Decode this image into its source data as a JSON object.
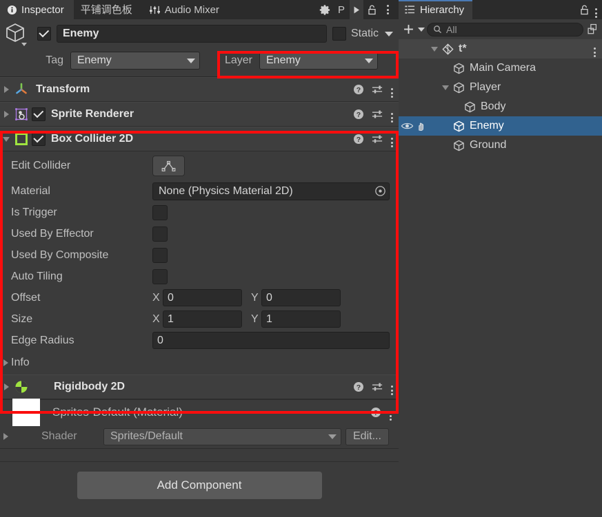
{
  "inspector": {
    "tabs": [
      {
        "label": "Inspector",
        "icon": "info-icon",
        "active": true
      },
      {
        "label": "平铺调色板",
        "icon": "",
        "active": false
      },
      {
        "label": "Audio Mixer",
        "icon": "mixer-icon",
        "active": false
      }
    ],
    "toolbar_right": [
      {
        "name": "gear-icon",
        "label": ""
      },
      {
        "name": "preview-p-label",
        "label": "P"
      },
      {
        "name": "play-icon",
        "label": ""
      },
      {
        "name": "lock-icon",
        "label": ""
      },
      {
        "name": "more-menu-icon",
        "label": ""
      }
    ],
    "object": {
      "icon": "gameobject-cube-icon",
      "enabled_checkbox": true,
      "name": "Enemy",
      "static_checkbox": false,
      "static_label": "Static",
      "tag_label": "Tag",
      "tag_value": "Enemy",
      "layer_label": "Layer",
      "layer_value": "Enemy"
    },
    "components": [
      {
        "title": "Transform",
        "icon": "transform-axis-icon",
        "expanded": false,
        "has_checkbox": false
      },
      {
        "title": "Sprite Renderer",
        "icon": "sprite-renderer-icon",
        "expanded": false,
        "has_checkbox": true,
        "checked": true
      },
      {
        "title": "Box Collider 2D",
        "icon": "box-collider-2d-icon",
        "expanded": true,
        "has_checkbox": true,
        "checked": true
      },
      {
        "title": "Rigidbody 2D",
        "icon": "rigidbody-2d-icon",
        "expanded": false,
        "has_checkbox": false
      }
    ],
    "box_collider": {
      "edit_collider_label": "Edit Collider",
      "edit_collider_button_icon": "polygon-edit-icon",
      "material_label": "Material",
      "material_value": "None (Physics Material 2D)",
      "is_trigger_label": "Is Trigger",
      "is_trigger_value": false,
      "used_by_effector_label": "Used By Effector",
      "used_by_effector_value": false,
      "used_by_composite_label": "Used By Composite",
      "used_by_composite_value": false,
      "auto_tiling_label": "Auto Tiling",
      "auto_tiling_value": false,
      "offset_label": "Offset",
      "offset_x_label": "X",
      "offset_x": "0",
      "offset_y_label": "Y",
      "offset_y": "0",
      "size_label": "Size",
      "size_x_label": "X",
      "size_x": "1",
      "size_y_label": "Y",
      "size_y": "1",
      "edge_radius_label": "Edge Radius",
      "edge_radius": "0",
      "info_label": "Info"
    },
    "material": {
      "title": "Sprites-Default (Material)",
      "swatch_color": "#ffffff",
      "shader_label": "Shader",
      "shader_value": "Sprites/Default",
      "edit_button_label": "Edit..."
    },
    "add_component_label": "Add Component"
  },
  "hierarchy": {
    "tab_label": "Hierarchy",
    "tab_icon": "hierarchy-icon",
    "lock_icon": "lock-icon",
    "more_icon": "more-menu-icon",
    "create_label": "+",
    "search_placeholder": "All",
    "items": [
      {
        "label": "t*",
        "depth": 0,
        "icon": "unity-scene-icon",
        "expanded": true,
        "selected": false,
        "is_scene": true,
        "has_menu": true
      },
      {
        "label": "Main Camera",
        "depth": 1,
        "icon": "gameobject-cube-icon",
        "expanded": null,
        "selected": false
      },
      {
        "label": "Player",
        "depth": 1,
        "icon": "gameobject-cube-icon",
        "expanded": true,
        "selected": false
      },
      {
        "label": "Body",
        "depth": 2,
        "icon": "gameobject-cube-icon",
        "expanded": null,
        "selected": false
      },
      {
        "label": "Enemy",
        "depth": 1,
        "icon": "gameobject-cube-icon",
        "expanded": null,
        "selected": true,
        "show_visibility": true
      },
      {
        "label": "Ground",
        "depth": 1,
        "icon": "gameobject-cube-icon",
        "expanded": null,
        "selected": false
      }
    ]
  },
  "annotations": {
    "highlight_color": "#fb0d0d",
    "boxes": [
      {
        "name": "layer-highlight"
      },
      {
        "name": "collider-section-highlight"
      }
    ]
  }
}
